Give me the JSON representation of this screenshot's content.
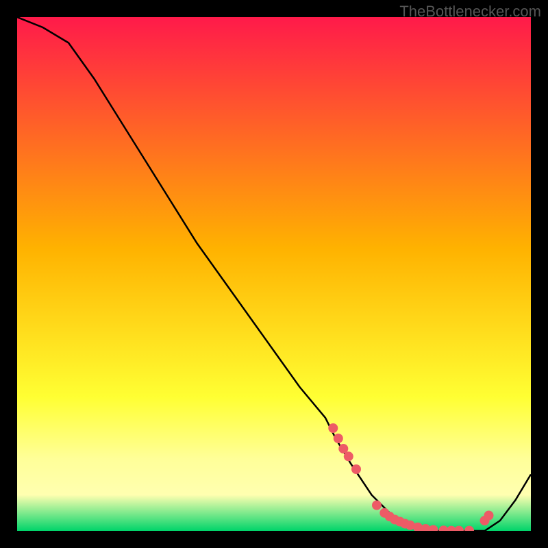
{
  "watermark": "TheBottlenecker.com",
  "chart_data": {
    "type": "line",
    "title": "",
    "xlabel": "",
    "ylabel": "",
    "xlim": [
      0,
      100
    ],
    "ylim": [
      0,
      100
    ],
    "grid": false,
    "gradient": {
      "top": "#ff1a4a",
      "mid_upper": "#ffb200",
      "mid_lower": "#ffff66",
      "yellow_band_top": "#ffff99",
      "yellow_band_bottom": "#ffffb0",
      "green": "#00d46a"
    },
    "series": [
      {
        "name": "bottleneck-curve",
        "x": [
          0,
          5,
          10,
          15,
          20,
          25,
          30,
          35,
          40,
          45,
          50,
          55,
          60,
          62,
          65,
          69,
          73,
          77,
          80,
          82,
          85,
          88,
          91,
          94,
          97,
          100
        ],
        "y": [
          100,
          98,
          95,
          88,
          80,
          72,
          64,
          56,
          49,
          42,
          35,
          28,
          22,
          18,
          13,
          7,
          3,
          1,
          0,
          0,
          0,
          0,
          0,
          2,
          6,
          11
        ]
      }
    ],
    "markers": {
      "name": "highlighted-points",
      "x": [
        61.5,
        62.5,
        63.5,
        64.5,
        66.0,
        70.0,
        71.5,
        72.5,
        73.5,
        74.5,
        75.5,
        76.5,
        78.0,
        79.5,
        81.0,
        83.0,
        84.5,
        86.0,
        88.0,
        91.0,
        91.8
      ],
      "y": [
        20.0,
        18.0,
        16.0,
        14.5,
        12.0,
        5.0,
        3.5,
        2.8,
        2.2,
        1.8,
        1.4,
        1.1,
        0.7,
        0.4,
        0.2,
        0.1,
        0.05,
        0.05,
        0.05,
        2.0,
        3.0
      ]
    }
  }
}
